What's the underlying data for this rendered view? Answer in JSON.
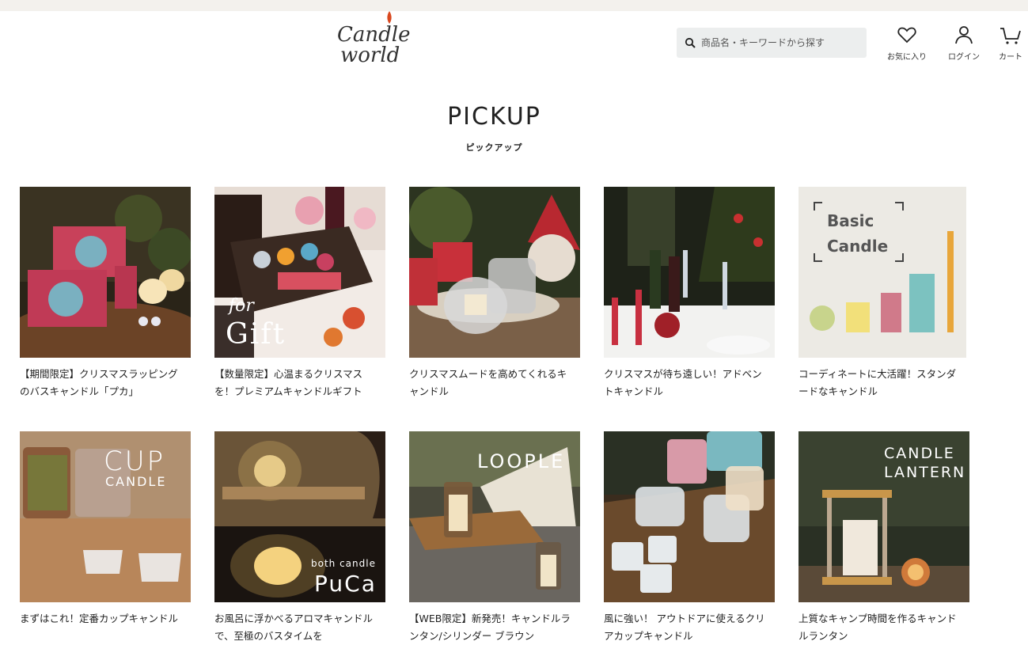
{
  "header": {
    "logo_text": "Candle world",
    "search": {
      "placeholder": "商品名・キーワードから探す"
    },
    "favorites_label": "お気に入り",
    "login_label": "ログイン",
    "cart_label": "カート"
  },
  "section": {
    "title": "PICKUP",
    "subtitle": "ピックアップ"
  },
  "cards": [
    {
      "caption": "【期間限定】クリスマスラッピングのバスキャンドル「プカ」",
      "overlay": ""
    },
    {
      "caption": "【数量限定】心温まるクリスマスを！プレミアムキャンドルギフト",
      "overlay": "for Gift"
    },
    {
      "caption": "クリスマスムードを高めてくれるキャンドル",
      "overlay": ""
    },
    {
      "caption": "クリスマスが待ち遠しい！アドベントキャンドル",
      "overlay": ""
    },
    {
      "caption": "コーディネートに大活躍！スタンダードなキャンドル",
      "overlay": "Basic Candle"
    },
    {
      "caption": "まずはこれ！定番カップキャンドル",
      "overlay": "CUP CANDLE"
    },
    {
      "caption": "お風呂に浮かべるアロマキャンドルで、至極のバスタイムを",
      "overlay": "both candle PuCa"
    },
    {
      "caption": "【WEB限定】新発売！キャンドルランタン/シリンダー ブラウン",
      "overlay": "LOOPLE"
    },
    {
      "caption": "風に強い！ アウトドアに使えるクリアカップキャンドル",
      "overlay": ""
    },
    {
      "caption": "上質なキャンプ時間を作るキャンドルランタン",
      "overlay": "CANDLE LANTERN"
    }
  ]
}
